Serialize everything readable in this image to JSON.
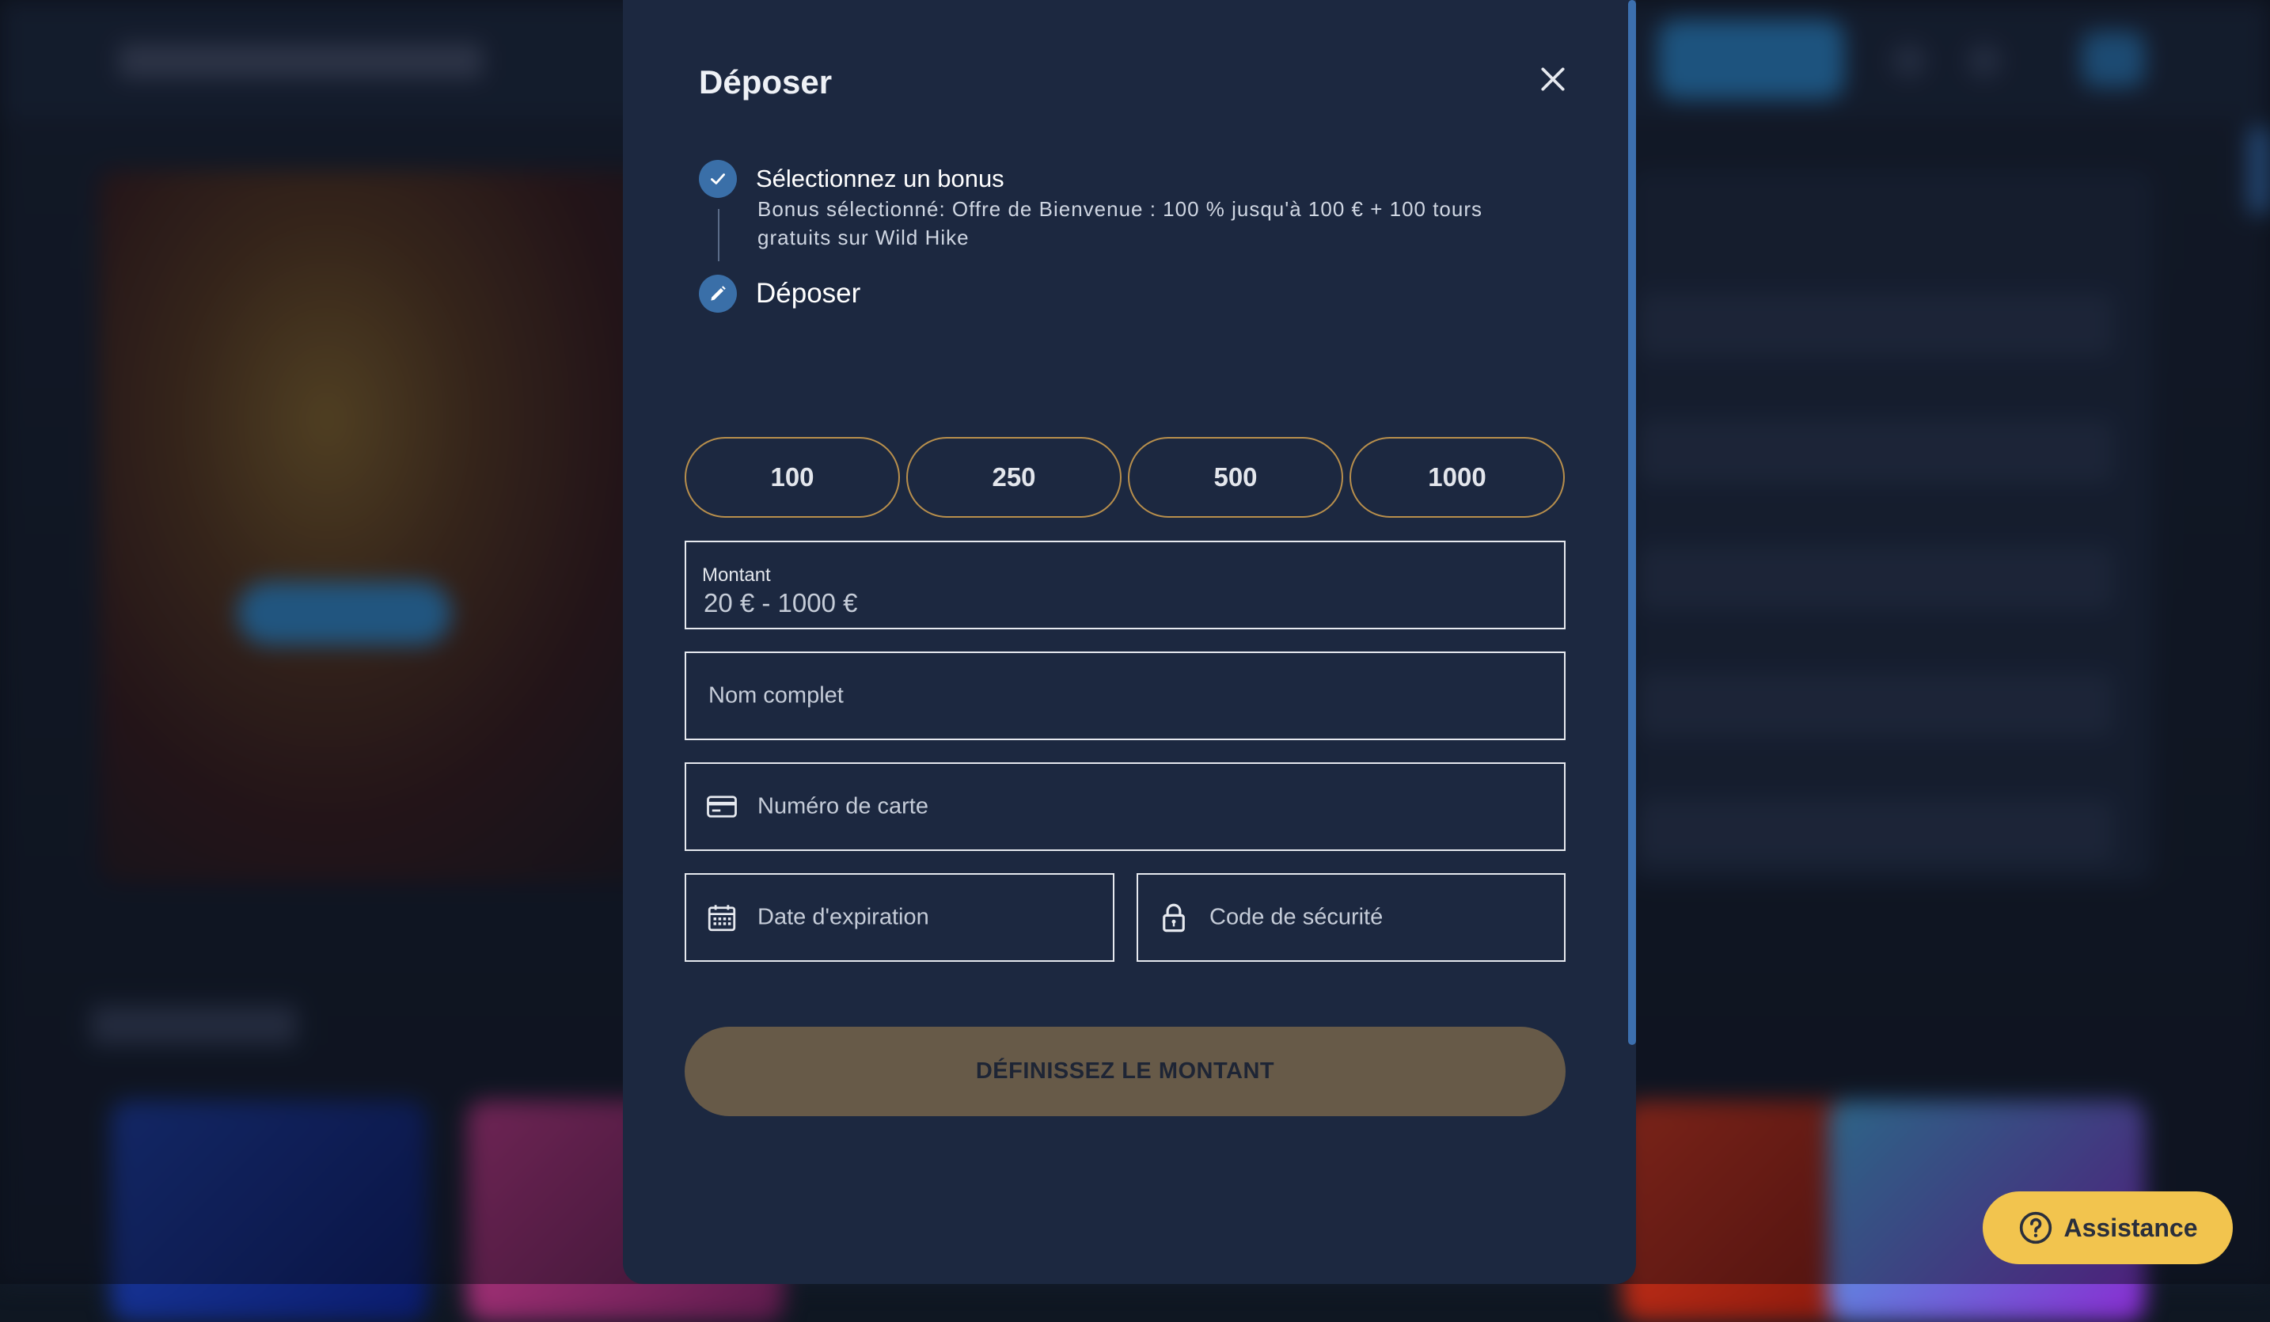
{
  "modal": {
    "title": "Déposer",
    "steps": [
      {
        "title": "Sélectionnez un bonus",
        "status": "completed",
        "icon": "check-icon"
      },
      {
        "title": "Déposer",
        "status": "active",
        "icon": "pencil-icon"
      }
    ],
    "bonus_description": "Bonus sélectionné: Offre de Bienvenue : 100 % jusqu'à 100 € + 100 tours gratuits sur Wild Hike",
    "amount_presets": [
      "100",
      "250",
      "500",
      "1000"
    ],
    "amount_field": {
      "label": "Montant",
      "placeholder": "20 € - 1000 €"
    },
    "full_name_field": {
      "placeholder": "Nom complet"
    },
    "card_number_field": {
      "placeholder": "Numéro de carte",
      "icon": "credit-card-icon"
    },
    "expiry_field": {
      "placeholder": "Date d'expiration",
      "icon": "calendar-icon"
    },
    "security_code_field": {
      "placeholder": "Code de sécurité",
      "icon": "lock-icon"
    },
    "submit_label": "DÉFINISSEZ LE MONTANT"
  },
  "assistance": {
    "label": "Assistance",
    "icon": "help-circle-icon"
  },
  "colors": {
    "modal_bg": "#1c2840",
    "step_circle": "#3a6fa8",
    "preset_border": "#b88f4c",
    "submit_bg": "#675a48",
    "assist_bg": "#f2c44e"
  }
}
